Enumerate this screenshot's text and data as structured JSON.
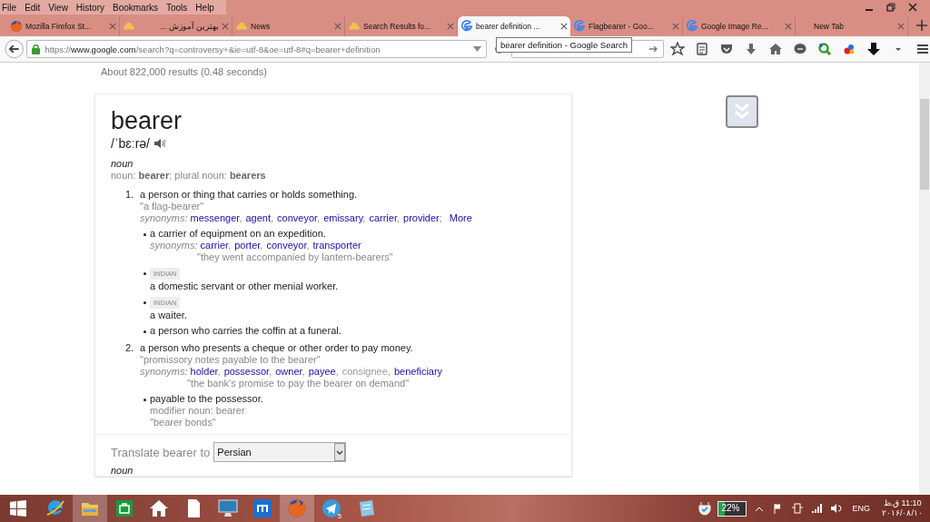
{
  "menu": [
    "File",
    "Edit",
    "View",
    "History",
    "Bookmarks",
    "Tools",
    "Help"
  ],
  "tabs": [
    {
      "label": "Mozilla Firefox St...",
      "kind": "firefox",
      "selected": false
    },
    {
      "label": "بهترین آموزش ...",
      "kind": "cloud",
      "selected": false
    },
    {
      "label": "News",
      "kind": "cloud",
      "selected": false
    },
    {
      "label": "Search Results fo...",
      "kind": "cloud",
      "selected": false
    },
    {
      "label": "bearer definition ...",
      "kind": "google",
      "selected": true
    },
    {
      "label": "Flagbearer - Goo...",
      "kind": "google",
      "selected": false
    },
    {
      "label": "Google Image Re...",
      "kind": "google",
      "selected": false
    },
    {
      "label": "New Tab",
      "kind": "blank",
      "selected": false
    }
  ],
  "address": {
    "scheme": "https://",
    "host": "www.google.com",
    "path": "/search?q=controversy+&ie=utf-8&oe=utf-8#q=bearer+definition"
  },
  "tooltip": "bearer definition - Google Search",
  "result_stats": "About 822,000 results (0.48 seconds)",
  "definition": {
    "word": "bearer",
    "pronunciation": "/ˈbɛːrə/",
    "part_of_speech": "noun",
    "forms": "noun: **bearer**; plural noun: **bearers**",
    "senses": [
      {
        "number": "1.",
        "lines": [
          {
            "kind": "definition",
            "text": "a person or thing that carries or holds something."
          },
          {
            "kind": "example",
            "text": "\"a flag-bearer\""
          },
          {
            "kind": "synonyms",
            "label": "synonyms:",
            "words": [
              {
                "text": "messenger",
                "link": true,
                "after": ","
              },
              {
                "text": "agent",
                "link": true,
                "after": ","
              },
              {
                "text": "conveyor",
                "link": true,
                "after": ","
              },
              {
                "text": "emissary",
                "link": true,
                "after": ","
              },
              {
                "text": "carrier",
                "link": true,
                "after": ","
              },
              {
                "text": "provider",
                "link": true,
                "after": ";"
              }
            ],
            "more": "More"
          }
        ],
        "subsenses": [
          {
            "lines": [
              {
                "kind": "definition",
                "text": "a carrier of equipment on an expedition."
              },
              {
                "kind": "synonyms",
                "label": "synonyms:",
                "words": [
                  {
                    "text": "carrier",
                    "link": true,
                    "after": ","
                  },
                  {
                    "text": "porter",
                    "link": true,
                    "after": ","
                  },
                  {
                    "text": "conveyor",
                    "link": true,
                    "after": ","
                  },
                  {
                    "text": "transporter",
                    "link": true
                  }
                ]
              },
              {
                "kind": "usage",
                "text": "\"they went accompanied by lantern-bearers\""
              }
            ]
          },
          {
            "lines": [
              {
                "kind": "register",
                "text": "INDIAN"
              },
              {
                "kind": "definition",
                "text": "a domestic servant or other menial worker."
              }
            ]
          },
          {
            "lines": [
              {
                "kind": "register",
                "text": "INDIAN"
              },
              {
                "kind": "definition",
                "text": "a waiter."
              }
            ]
          },
          {
            "lines": [
              {
                "kind": "definition",
                "text": "a person who carries the coffin at a funeral."
              }
            ]
          }
        ]
      },
      {
        "number": "2.",
        "lines": [
          {
            "kind": "definition",
            "text": "a person who presents a cheque or other order to pay money."
          },
          {
            "kind": "example",
            "text": "\"promissory notes payable to the bearer\""
          },
          {
            "kind": "synonyms",
            "label": "synonyms:",
            "words": [
              {
                "text": "holder",
                "link": true,
                "after": ","
              },
              {
                "text": "possessor",
                "link": true,
                "after": ","
              },
              {
                "text": "owner",
                "link": true,
                "after": ","
              },
              {
                "text": "payee",
                "link": true,
                "after": ","
              },
              {
                "text": "consignee",
                "link": false,
                "after": ","
              },
              {
                "text": "beneficiary",
                "link": true
              }
            ]
          },
          {
            "kind": "usage",
            "text": "\"the bank's promise to pay the bearer on demand\""
          }
        ],
        "subsenses": [
          {
            "lines": [
              {
                "kind": "definition",
                "text": "payable to the possessor."
              },
              {
                "kind": "grammar",
                "text": "modifier noun: bearer"
              },
              {
                "kind": "example",
                "text": "\"bearer bonds\""
              }
            ]
          }
        ]
      }
    ]
  },
  "translate": {
    "label": "Translate bearer to",
    "language": "Persian"
  },
  "next_part_of_speech": "noun",
  "taskbar": {
    "apps": [
      {
        "kind": "ie",
        "active": false
      },
      {
        "kind": "folder",
        "active": true
      },
      {
        "kind": "store",
        "active": false
      },
      {
        "kind": "home",
        "active": false
      },
      {
        "kind": "document",
        "active": false
      },
      {
        "kind": "monitor",
        "active": false
      },
      {
        "kind": "maxthon",
        "active": false
      },
      {
        "kind": "firefox",
        "active": true
      },
      {
        "kind": "telegram",
        "active": false,
        "badge": "5"
      },
      {
        "kind": "notepad",
        "active": false
      }
    ],
    "battery": {
      "text": "22%",
      "level": 0.22
    },
    "language": "ENG",
    "time": "11:10 ق.ظ",
    "date": "۲۰۱۶/۰۸/۱۰"
  }
}
